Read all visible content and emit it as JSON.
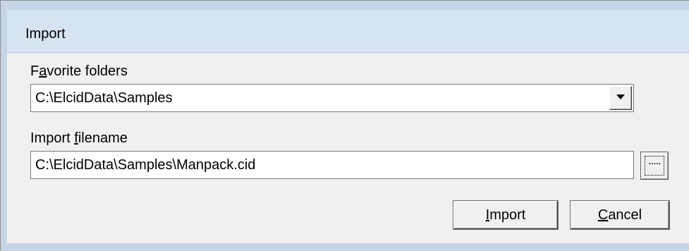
{
  "window": {
    "title": "Import"
  },
  "favorite_folders": {
    "label_pre": "F",
    "label_access": "a",
    "label_post": "vorite folders",
    "value": "C:\\ElcidData\\Samples"
  },
  "import_filename": {
    "label_pre": "Import ",
    "label_access": "f",
    "label_post": "ilename",
    "value": "C:\\ElcidData\\Samples\\Manpack.cid",
    "browse_label": "....."
  },
  "buttons": {
    "import_access": "I",
    "import_rest": "mport",
    "cancel_access": "C",
    "cancel_rest": "ancel"
  },
  "icons": {
    "combo_arrow": "chevron-down-icon",
    "browse": "ellipsis-icon"
  }
}
